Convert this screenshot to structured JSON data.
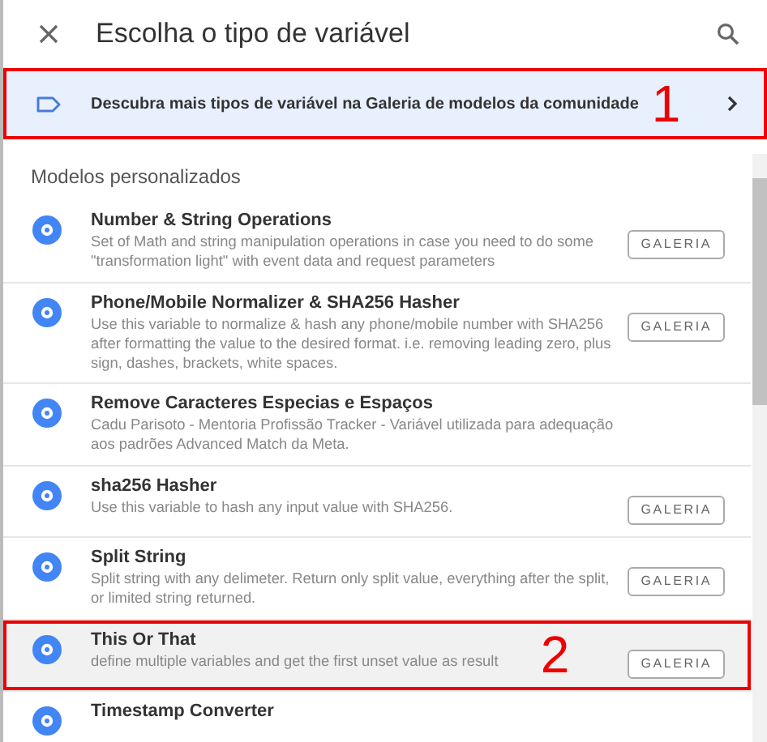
{
  "header": {
    "title": "Escolha o tipo de variável"
  },
  "banner": {
    "text": "Descubra mais tipos de variável na Galeria de modelos da comunidade",
    "annotation": "1"
  },
  "section": {
    "title": "Modelos personalizados"
  },
  "items": [
    {
      "title": "Number & String Operations",
      "description": "Set of Math and string manipulation operations in case you need to do some \"transformation light\" with event data and request parameters",
      "button": "GALERIA",
      "hovered": false
    },
    {
      "title": "Phone/Mobile Normalizer & SHA256 Hasher",
      "description": "Use this variable to normalize & hash any phone/mobile number with SHA256 after formatting the value to the desired format. i.e. removing leading zero, plus sign, dashes, brackets, white spaces.",
      "button": "GALERIA",
      "hovered": false
    },
    {
      "title": "Remove Caracteres Especias e Espaços",
      "description": "Cadu Parisoto - Mentoria Profissão Tracker - Variável utilizada para adequação aos padrões Advanced Match da Meta.",
      "hovered": false
    },
    {
      "title": "sha256 Hasher",
      "description": "Use this variable to hash any input value with SHA256.",
      "button": "GALERIA",
      "hovered": false
    },
    {
      "title": "Split String",
      "description": "Split string with any delimeter. Return only split value, everything after the split, or limited string returned.",
      "button": "GALERIA",
      "hovered": false
    },
    {
      "title": "This Or That",
      "description": "define multiple variables and get the first unset value as result",
      "button": "GALERIA",
      "hovered": true,
      "annotation": "2"
    },
    {
      "title": "Timestamp Converter",
      "hovered": false
    }
  ]
}
